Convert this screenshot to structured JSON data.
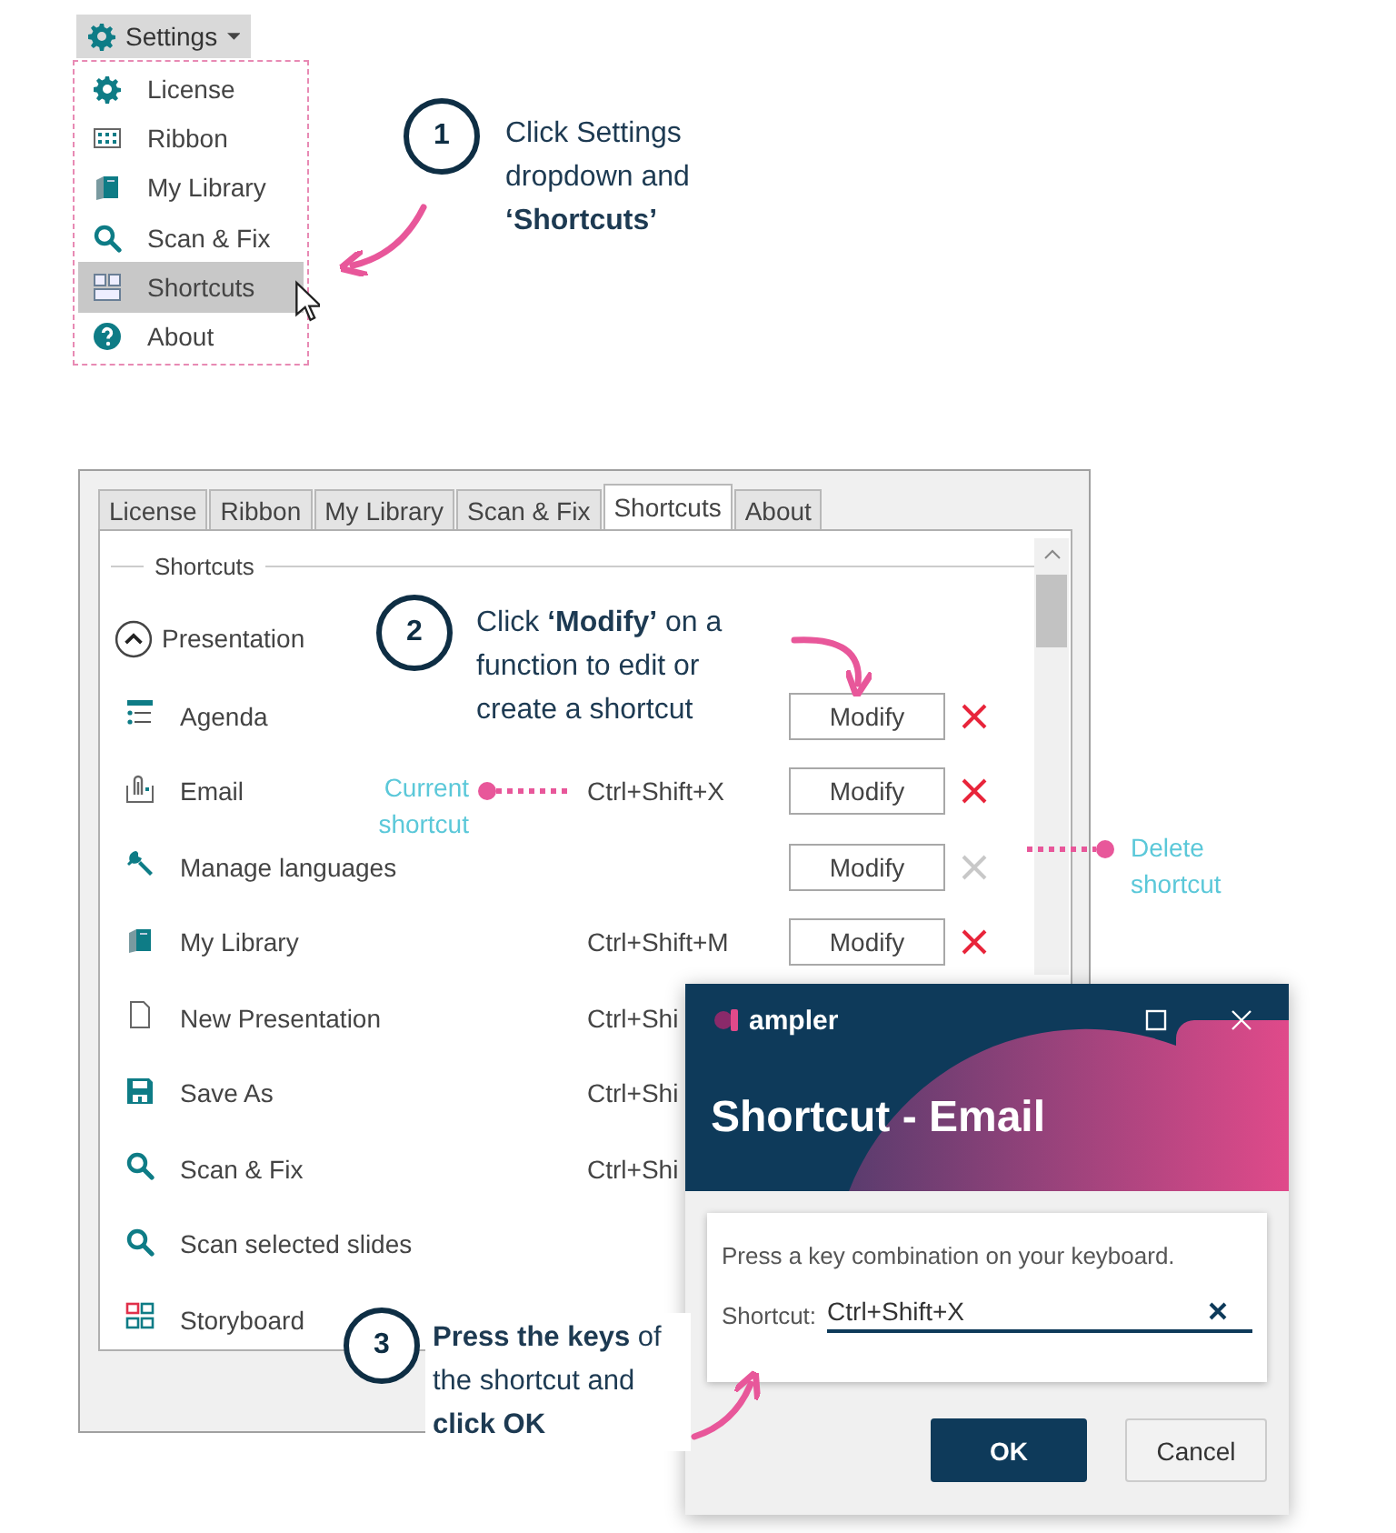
{
  "settings_menu": {
    "button": "Settings",
    "items": [
      {
        "label": "License",
        "selected": false
      },
      {
        "label": "Ribbon",
        "selected": false
      },
      {
        "label": "My Library",
        "selected": false
      },
      {
        "label": "Scan & Fix",
        "selected": false
      },
      {
        "label": "Shortcuts",
        "selected": true
      },
      {
        "label": "About",
        "selected": false
      }
    ]
  },
  "settings_window": {
    "tabs": [
      {
        "label": "License",
        "selected": false
      },
      {
        "label": "Ribbon",
        "selected": false
      },
      {
        "label": "My Library",
        "selected": false
      },
      {
        "label": "Scan & Fix",
        "selected": false
      },
      {
        "label": "Shortcuts",
        "selected": true
      },
      {
        "label": "About",
        "selected": false
      }
    ],
    "group_title": "Shortcuts",
    "section": {
      "label": "Presentation",
      "expanded": true
    },
    "rows": [
      {
        "label": "Agenda",
        "modify": "Modify",
        "delete_enabled": true
      },
      {
        "label": "Email",
        "shortcut": "Ctrl+Shift+X",
        "modify": "Modify",
        "delete_enabled": true
      },
      {
        "label": "Manage languages",
        "modify": "Modify",
        "delete_enabled": false
      },
      {
        "label": "My Library",
        "shortcut": "Ctrl+Shift+M",
        "modify": "Modify",
        "delete_enabled": true
      },
      {
        "label": "New Presentation",
        "shortcut": "Ctrl+Shi"
      },
      {
        "label": "Save As",
        "shortcut": "Ctrl+Shi"
      },
      {
        "label": "Scan & Fix",
        "shortcut": "Ctrl+Shi"
      },
      {
        "label": "Scan selected slides"
      },
      {
        "label": "Storyboard"
      }
    ]
  },
  "dialog": {
    "brand": "ampler",
    "title": "Shortcut - Email",
    "instruction": "Press a key combination on your keyboard.",
    "field_label": "Shortcut:",
    "value": "Ctrl+Shift+X",
    "buttons": [
      "OK",
      "Cancel"
    ]
  },
  "callouts": [
    {
      "number": "1",
      "text": "Click Settings dropdown and **‘Shortcuts’**"
    },
    {
      "number": "2",
      "text": "Click **‘Modify’** on a function to edit or create a shortcut"
    },
    {
      "number": "3",
      "text": "**Press the keys** of the shortcut and **click OK**"
    }
  ],
  "annotations": [
    {
      "text": "Current shortcut"
    },
    {
      "text": "Delete shortcut"
    }
  ]
}
